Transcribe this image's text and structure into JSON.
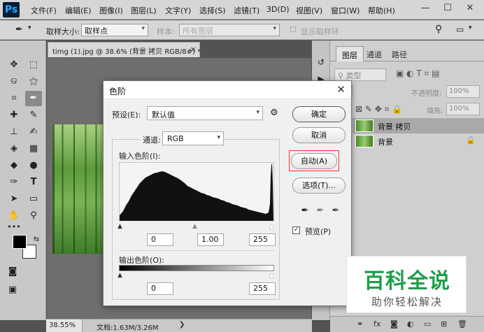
{
  "app": {
    "logo": "Ps"
  },
  "menu": [
    "文件(F)",
    "编辑(E)",
    "图像(I)",
    "图层(L)",
    "文字(Y)",
    "选择(S)",
    "滤镜(T)",
    "3D(D)",
    "视图(V)",
    "窗口(W)",
    "帮助(H)"
  ],
  "window_controls": {
    "minimize": "—",
    "restore": "☐",
    "close": "✕"
  },
  "options_bar": {
    "sample_size_label": "取样大小:",
    "sample_size_value": "取样点",
    "sample_label": "样本:",
    "sample_value": "所有图层",
    "show_ring_label": "显示取样环"
  },
  "document": {
    "tab_title": "timg (1).jpg @ 38.6% (背景 拷贝  RGB/8#) *",
    "zoom": "38.55%",
    "doc_info": "文档:1.63M/3.26M"
  },
  "layers_panel": {
    "tabs": [
      "图层",
      "通道",
      "路径"
    ],
    "filter_label": "类型",
    "opacity_label": "不透明度:",
    "opacity_value": "100%",
    "fill_label": "填充:",
    "fill_value": "100%",
    "layers": [
      {
        "name": "背景 拷贝",
        "selected": true
      },
      {
        "name": "背景",
        "selected": false
      }
    ]
  },
  "levels_dialog": {
    "title": "色阶",
    "preset_label": "预设(E):",
    "preset_value": "默认值",
    "channel_label": "通道:",
    "channel_value": "RGB",
    "input_levels_label": "输入色阶(I):",
    "input_black": "0",
    "input_gamma": "1.00",
    "input_white": "255",
    "output_levels_label": "输出色阶(O):",
    "output_black": "0",
    "output_white": "255",
    "buttons": {
      "ok": "确定",
      "cancel": "取消",
      "auto": "自动(A)",
      "options": "选项(T)..."
    },
    "preview_label": "预览(P)",
    "preview_checked": true
  },
  "watermark": {
    "title": "百科全说",
    "subtitle": "助你轻松解决"
  },
  "colors": {
    "highlight": "#e33333",
    "watermark_green": "#1f9e49",
    "ps_blue": "#31a8ff"
  }
}
